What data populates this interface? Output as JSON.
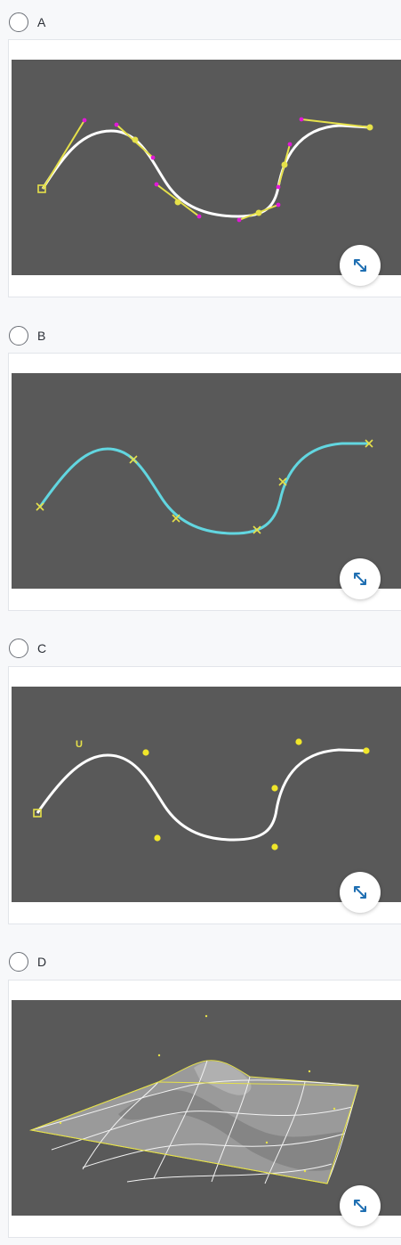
{
  "options": [
    {
      "label": "A",
      "figure": "curve-with-tangent-handles"
    },
    {
      "label": "B",
      "figure": "cyan-curve-with-edit-points"
    },
    {
      "label": "C",
      "figure": "curve-with-control-vertices"
    },
    {
      "label": "D",
      "figure": "wireframe-surface"
    }
  ],
  "figure_text": {
    "u_marker": "U"
  },
  "icons": {
    "expand": "expand-arrows-icon",
    "radio": "radio-unchecked-icon"
  },
  "colors": {
    "canvas_bg": "#595959",
    "curve_white": "#ffffff",
    "curve_cyan": "#62d6e0",
    "handle_yellow": "#e6e14a",
    "handle_magenta": "#e019d6",
    "expand_icon": "#1f6fb2"
  }
}
